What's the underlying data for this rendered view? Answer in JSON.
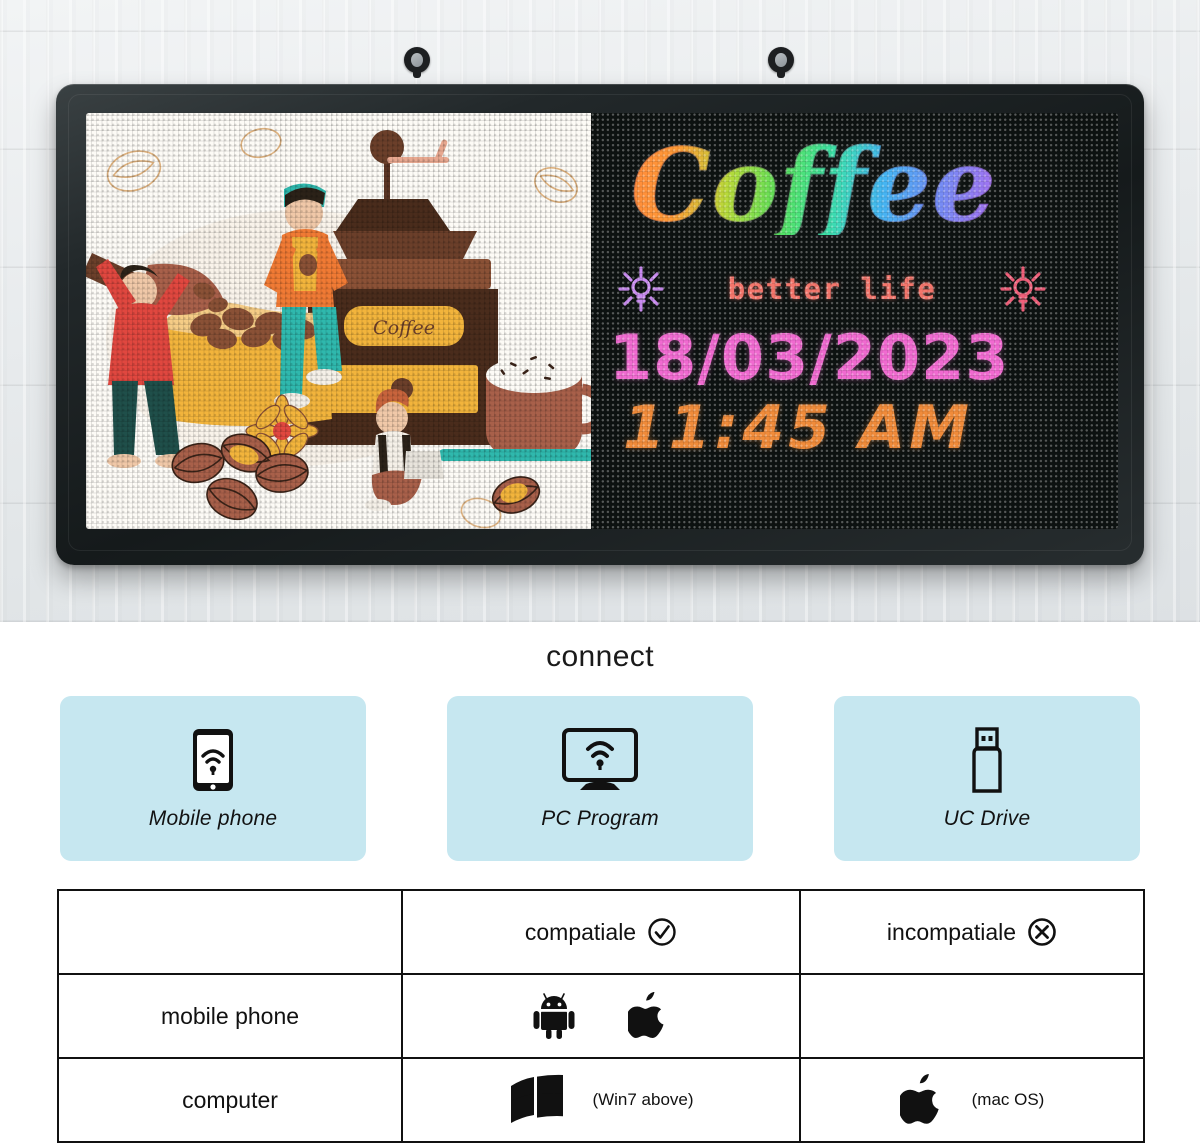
{
  "hero": {
    "product": "led-scrolling-sign",
    "mount_hardware": "hanging-eyelet",
    "display": {
      "left_panel": {
        "type": "coffee-shop-illustration",
        "sign_text": "Coffee"
      },
      "right_panel": {
        "headline": "Coffee",
        "tagline": "better life",
        "date": "18/03/2023",
        "time": "11:45 AM",
        "headline_gradient": [
          "#ff8a3d",
          "#ff9a35",
          "#b8d93a",
          "#59e05a",
          "#3ce2a6",
          "#43b7f2",
          "#6f8ff5",
          "#a96ff0"
        ],
        "tagline_color": "#f4766c",
        "date_color": "#f06ad0",
        "time_color": "#f08b3a",
        "panel_color": "#0d1211",
        "left_burst_color": "#c98bf0",
        "right_burst_color": "#f0607a"
      }
    }
  },
  "connect": {
    "title": "connect",
    "card_color": "#c6e7f0",
    "cards": [
      {
        "icon": "mobile-phone-wifi-icon",
        "label": "Mobile phone"
      },
      {
        "icon": "monitor-wifi-icon",
        "label": "PC Program"
      },
      {
        "icon": "usb-drive-icon",
        "label": "UC Drive"
      }
    ]
  },
  "compat_table": {
    "header": {
      "blank": "",
      "compatible_label": "compatiale",
      "compatible_icon": "circle-check-icon",
      "incompatible_label": "incompatiale",
      "incompatible_icon": "circle-x-icon"
    },
    "rows": [
      {
        "label": "mobile phone",
        "compatible_icons": [
          "android-icon",
          "apple-icon"
        ],
        "compatible_note": "",
        "incompatible_icons": [],
        "incompatible_note": ""
      },
      {
        "label": "computer",
        "compatible_icons": [
          "windows-icon"
        ],
        "compatible_note": "(Win7 above)",
        "incompatible_icons": [
          "apple-icon"
        ],
        "incompatible_note": "(mac OS)"
      }
    ]
  }
}
